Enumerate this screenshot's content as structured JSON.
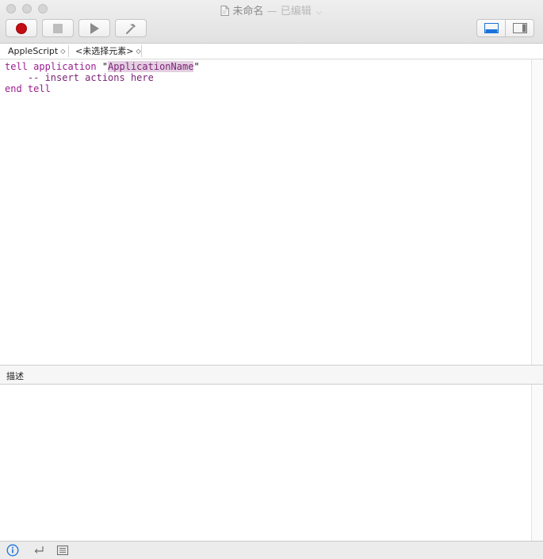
{
  "window": {
    "title": "未命名",
    "edited": "— 已编辑",
    "dropdown_chevron": "⌵"
  },
  "toolbar": {
    "record": "record-button",
    "stop": "stop-button",
    "run": "run-button",
    "compile": "compile-button",
    "view_toggle": [
      "show-bottom-pane",
      "show-sidebar"
    ]
  },
  "navigation": {
    "language": "AppleScript",
    "element": "<未选择元素>",
    "updown_glyph": "◇"
  },
  "editor": {
    "lines": [
      {
        "a": "tell application ",
        "b": "\"",
        "c": "ApplicationName",
        "d": "\""
      },
      {
        "comment": "    -- insert actions here"
      },
      {
        "kw": "end tell"
      }
    ]
  },
  "description": {
    "label": "描述"
  },
  "bottom_bar": {
    "icons": [
      "info-icon",
      "return-icon",
      "list-icon"
    ]
  },
  "colors": {
    "keyword": "#9a1d8e",
    "record_red": "#c30d12",
    "accent_blue": "#1a73d9",
    "selection": "#e3cfe1"
  }
}
